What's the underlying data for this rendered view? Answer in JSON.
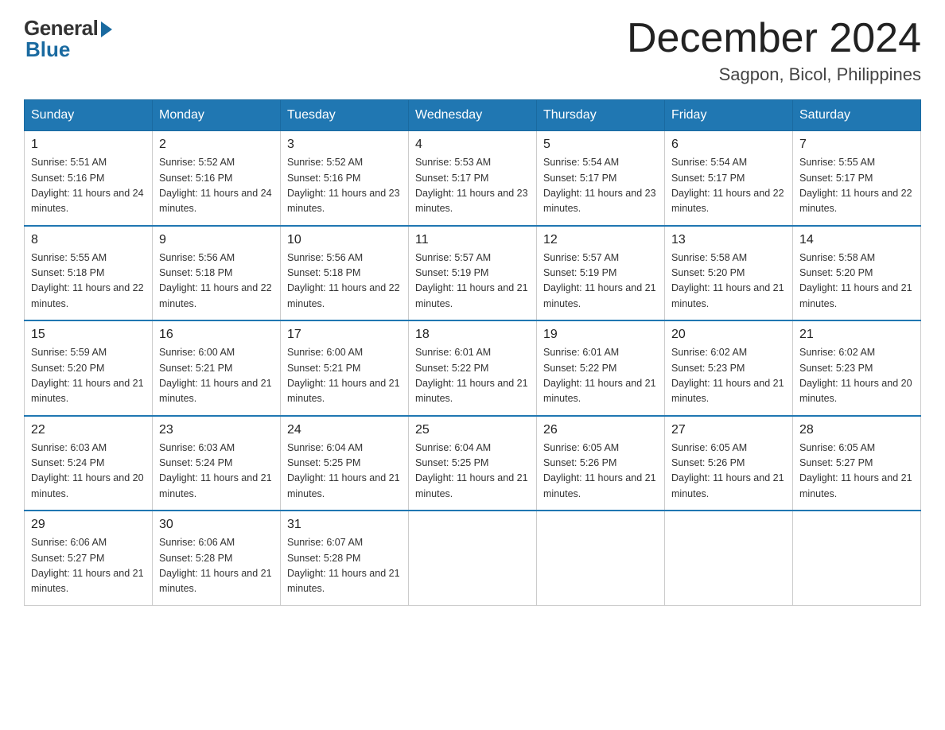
{
  "logo": {
    "general": "General",
    "blue": "Blue"
  },
  "title": "December 2024",
  "location": "Sagpon, Bicol, Philippines",
  "headers": [
    "Sunday",
    "Monday",
    "Tuesday",
    "Wednesday",
    "Thursday",
    "Friday",
    "Saturday"
  ],
  "weeks": [
    [
      {
        "day": "1",
        "sunrise": "5:51 AM",
        "sunset": "5:16 PM",
        "daylight": "11 hours and 24 minutes."
      },
      {
        "day": "2",
        "sunrise": "5:52 AM",
        "sunset": "5:16 PM",
        "daylight": "11 hours and 24 minutes."
      },
      {
        "day": "3",
        "sunrise": "5:52 AM",
        "sunset": "5:16 PM",
        "daylight": "11 hours and 23 minutes."
      },
      {
        "day": "4",
        "sunrise": "5:53 AM",
        "sunset": "5:17 PM",
        "daylight": "11 hours and 23 minutes."
      },
      {
        "day": "5",
        "sunrise": "5:54 AM",
        "sunset": "5:17 PM",
        "daylight": "11 hours and 23 minutes."
      },
      {
        "day": "6",
        "sunrise": "5:54 AM",
        "sunset": "5:17 PM",
        "daylight": "11 hours and 22 minutes."
      },
      {
        "day": "7",
        "sunrise": "5:55 AM",
        "sunset": "5:17 PM",
        "daylight": "11 hours and 22 minutes."
      }
    ],
    [
      {
        "day": "8",
        "sunrise": "5:55 AM",
        "sunset": "5:18 PM",
        "daylight": "11 hours and 22 minutes."
      },
      {
        "day": "9",
        "sunrise": "5:56 AM",
        "sunset": "5:18 PM",
        "daylight": "11 hours and 22 minutes."
      },
      {
        "day": "10",
        "sunrise": "5:56 AM",
        "sunset": "5:18 PM",
        "daylight": "11 hours and 22 minutes."
      },
      {
        "day": "11",
        "sunrise": "5:57 AM",
        "sunset": "5:19 PM",
        "daylight": "11 hours and 21 minutes."
      },
      {
        "day": "12",
        "sunrise": "5:57 AM",
        "sunset": "5:19 PM",
        "daylight": "11 hours and 21 minutes."
      },
      {
        "day": "13",
        "sunrise": "5:58 AM",
        "sunset": "5:20 PM",
        "daylight": "11 hours and 21 minutes."
      },
      {
        "day": "14",
        "sunrise": "5:58 AM",
        "sunset": "5:20 PM",
        "daylight": "11 hours and 21 minutes."
      }
    ],
    [
      {
        "day": "15",
        "sunrise": "5:59 AM",
        "sunset": "5:20 PM",
        "daylight": "11 hours and 21 minutes."
      },
      {
        "day": "16",
        "sunrise": "6:00 AM",
        "sunset": "5:21 PM",
        "daylight": "11 hours and 21 minutes."
      },
      {
        "day": "17",
        "sunrise": "6:00 AM",
        "sunset": "5:21 PM",
        "daylight": "11 hours and 21 minutes."
      },
      {
        "day": "18",
        "sunrise": "6:01 AM",
        "sunset": "5:22 PM",
        "daylight": "11 hours and 21 minutes."
      },
      {
        "day": "19",
        "sunrise": "6:01 AM",
        "sunset": "5:22 PM",
        "daylight": "11 hours and 21 minutes."
      },
      {
        "day": "20",
        "sunrise": "6:02 AM",
        "sunset": "5:23 PM",
        "daylight": "11 hours and 21 minutes."
      },
      {
        "day": "21",
        "sunrise": "6:02 AM",
        "sunset": "5:23 PM",
        "daylight": "11 hours and 20 minutes."
      }
    ],
    [
      {
        "day": "22",
        "sunrise": "6:03 AM",
        "sunset": "5:24 PM",
        "daylight": "11 hours and 20 minutes."
      },
      {
        "day": "23",
        "sunrise": "6:03 AM",
        "sunset": "5:24 PM",
        "daylight": "11 hours and 21 minutes."
      },
      {
        "day": "24",
        "sunrise": "6:04 AM",
        "sunset": "5:25 PM",
        "daylight": "11 hours and 21 minutes."
      },
      {
        "day": "25",
        "sunrise": "6:04 AM",
        "sunset": "5:25 PM",
        "daylight": "11 hours and 21 minutes."
      },
      {
        "day": "26",
        "sunrise": "6:05 AM",
        "sunset": "5:26 PM",
        "daylight": "11 hours and 21 minutes."
      },
      {
        "day": "27",
        "sunrise": "6:05 AM",
        "sunset": "5:26 PM",
        "daylight": "11 hours and 21 minutes."
      },
      {
        "day": "28",
        "sunrise": "6:05 AM",
        "sunset": "5:27 PM",
        "daylight": "11 hours and 21 minutes."
      }
    ],
    [
      {
        "day": "29",
        "sunrise": "6:06 AM",
        "sunset": "5:27 PM",
        "daylight": "11 hours and 21 minutes."
      },
      {
        "day": "30",
        "sunrise": "6:06 AM",
        "sunset": "5:28 PM",
        "daylight": "11 hours and 21 minutes."
      },
      {
        "day": "31",
        "sunrise": "6:07 AM",
        "sunset": "5:28 PM",
        "daylight": "11 hours and 21 minutes."
      },
      null,
      null,
      null,
      null
    ]
  ]
}
